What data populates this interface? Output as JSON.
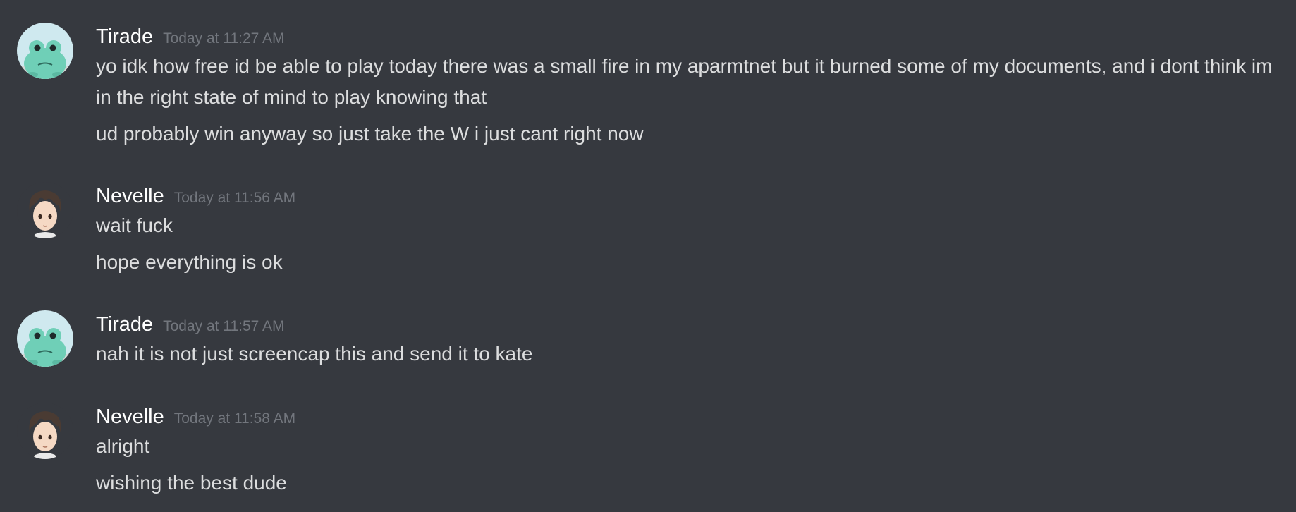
{
  "messages": [
    {
      "username": "Tirade",
      "avatar": "frog-avatar",
      "timestamp": "Today at 11:27 AM",
      "lines": [
        "yo idk how free id be able to play today there was a small fire in my aparmtnet but it burned some of my documents, and i dont think im in the right state of mind to play knowing that",
        "ud probably win anyway so just take the W i just cant right now"
      ]
    },
    {
      "username": "Nevelle",
      "avatar": "anime-boy-avatar",
      "timestamp": "Today at 11:56 AM",
      "lines": [
        "wait fuck",
        "hope everything is ok"
      ]
    },
    {
      "username": "Tirade",
      "avatar": "frog-avatar",
      "timestamp": "Today at 11:57 AM",
      "lines": [
        "nah it is not just screencap this and send it to kate"
      ]
    },
    {
      "username": "Nevelle",
      "avatar": "anime-boy-avatar",
      "timestamp": "Today at 11:58 AM",
      "lines": [
        "alright",
        "wishing the best dude"
      ]
    }
  ],
  "colors": {
    "background": "#36393f",
    "username": "#ffffff",
    "message_text": "#dcddde",
    "timestamp": "#72767d",
    "frog_green": "#6fcfb7",
    "frog_bg": "#cfe9ef"
  }
}
